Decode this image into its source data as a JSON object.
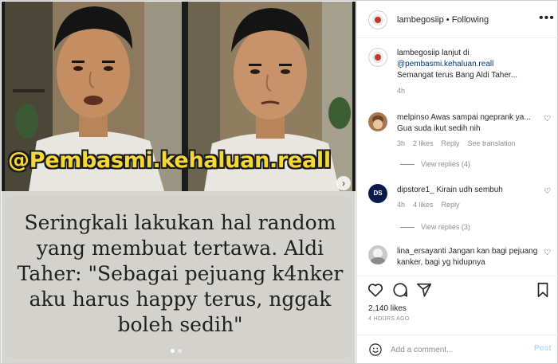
{
  "post": {
    "watermark": "@Pembasmi.kehaluan.reall",
    "caption_lines": [
      "Seringkali lakukan hal random",
      "yang membuat tertawa. Aldi",
      "Taher: \"Sebagai pejuang k4nker",
      "aku harus happy terus, nggak",
      "boleh sedih\""
    ],
    "next_icon": "chevron-right-icon"
  },
  "header": {
    "username": "lambegosiip",
    "separator": "•",
    "follow_status": "Following",
    "more_icon": "more-horizontal-icon"
  },
  "comments": [
    {
      "username": "lambegosiip",
      "text_before_link": "lanjut di",
      "link": "@pembasmi.kehaluan.reall",
      "text_after_link": "Semangat terus Bang Aldi Taher...",
      "time": "4h"
    },
    {
      "username": "melpinso",
      "text": "Awas sampai ngeprank ya... Gua suda ikut sedih nih",
      "time": "3h",
      "likes": "2 likes",
      "reply": "Reply",
      "translate": "See translation",
      "view_replies": "View replies (4)"
    },
    {
      "username": "dipstore1_",
      "text": "Kirain udh sembuh",
      "time": "4h",
      "likes": "4 likes",
      "reply": "Reply",
      "view_replies": "View replies (3)",
      "avatar_text": "DS"
    },
    {
      "username": "lina_ersayanti",
      "text": "Jangan kan bagi pejuang kanker, bagi yg hidupnya"
    }
  ],
  "actions": {
    "like_icon": "heart-icon",
    "comment_icon": "comment-icon",
    "share_icon": "send-icon",
    "save_icon": "bookmark-icon",
    "likes_count": "2,140 likes",
    "timestamp": "4 HOURS AGO"
  },
  "composer": {
    "emoji_icon": "smiley-icon",
    "placeholder": "Add a comment...",
    "post_label": "Post"
  },
  "colors": {
    "link": "#00376b",
    "watermark": "#f4d83a",
    "post_disabled": "#b2dffc",
    "caption_bg": "#d4d2cd"
  }
}
